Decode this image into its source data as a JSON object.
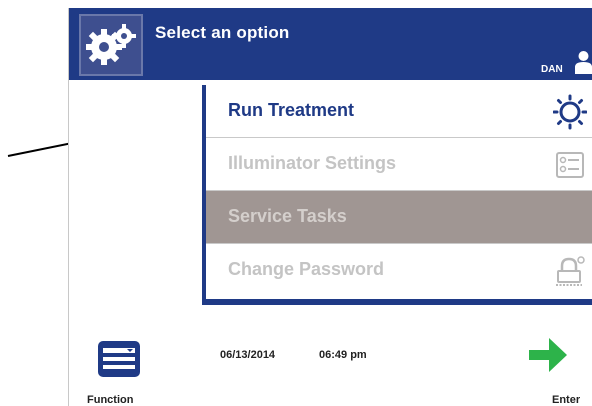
{
  "header": {
    "title": "Select an option",
    "user": "DAN"
  },
  "menu": {
    "items": [
      {
        "label": "Run Treatment",
        "icon": "sun-icon",
        "state": "enabled"
      },
      {
        "label": "Illuminator Settings",
        "icon": "settings-list-icon",
        "state": "disabled"
      },
      {
        "label": "Service Tasks",
        "icon": "",
        "state": "selected-disabled"
      },
      {
        "label": "Change Password",
        "icon": "lock-key-icon",
        "state": "disabled"
      }
    ]
  },
  "footer": {
    "function_label": "Function",
    "date": "06/13/2014",
    "time": "06:49 pm",
    "enter_label": "Enter"
  },
  "colors": {
    "header_bg": "#1f3a86",
    "selected_row": "#a09693",
    "enter_arrow": "#2db34a"
  }
}
